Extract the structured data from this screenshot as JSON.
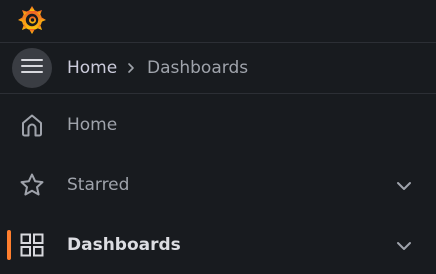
{
  "breadcrumb": {
    "home": "Home",
    "current": "Dashboards"
  },
  "nav": {
    "items": [
      {
        "label": "Home",
        "icon": "home-icon",
        "has_chevron": false,
        "active": false
      },
      {
        "label": "Starred",
        "icon": "star-icon",
        "has_chevron": true,
        "active": false
      },
      {
        "label": "Dashboards",
        "icon": "apps-grid-icon",
        "has_chevron": true,
        "active": true
      }
    ]
  },
  "colors": {
    "background": "#181b1f",
    "accent": "#ff7f2e",
    "text_muted": "#9fa3ab",
    "text_primary": "#dcdde2"
  }
}
